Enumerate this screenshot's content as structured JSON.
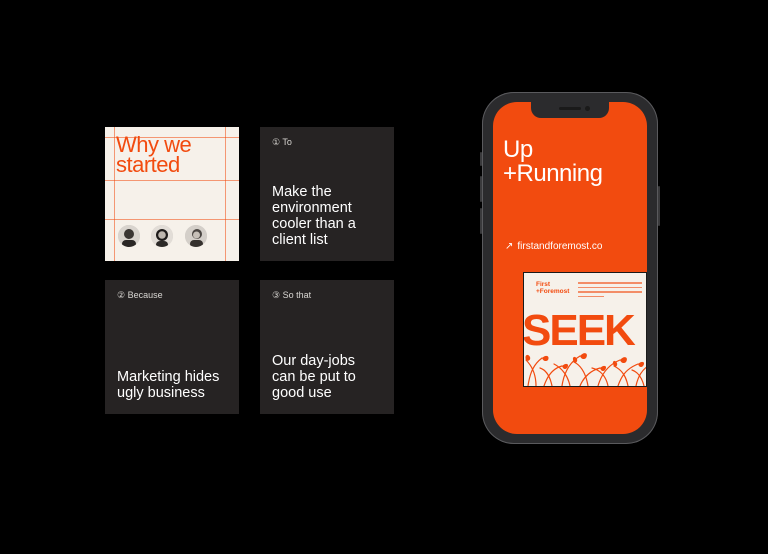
{
  "colors": {
    "accent": "#f24b0f",
    "card_dark": "#262323",
    "card_light": "#f6f1ea",
    "background": "#000000"
  },
  "cards": {
    "intro": {
      "heading": "Why we\nstarted"
    },
    "to": {
      "step": "① To",
      "body": "Make the\nenvironment\ncooler than a\nclient list"
    },
    "because": {
      "step": "② Because",
      "body": "Marketing hides\nugly business"
    },
    "so_that": {
      "step": "③ So that",
      "body": "Our day-jobs\ncan be put to\ngood use"
    }
  },
  "phone": {
    "headline": "Up\n+Running",
    "link_icon": "arrow-up-right-icon",
    "link": "firstandforemost.co",
    "poster": {
      "brand": "First\n+Foremost",
      "word": "SEEK"
    }
  }
}
